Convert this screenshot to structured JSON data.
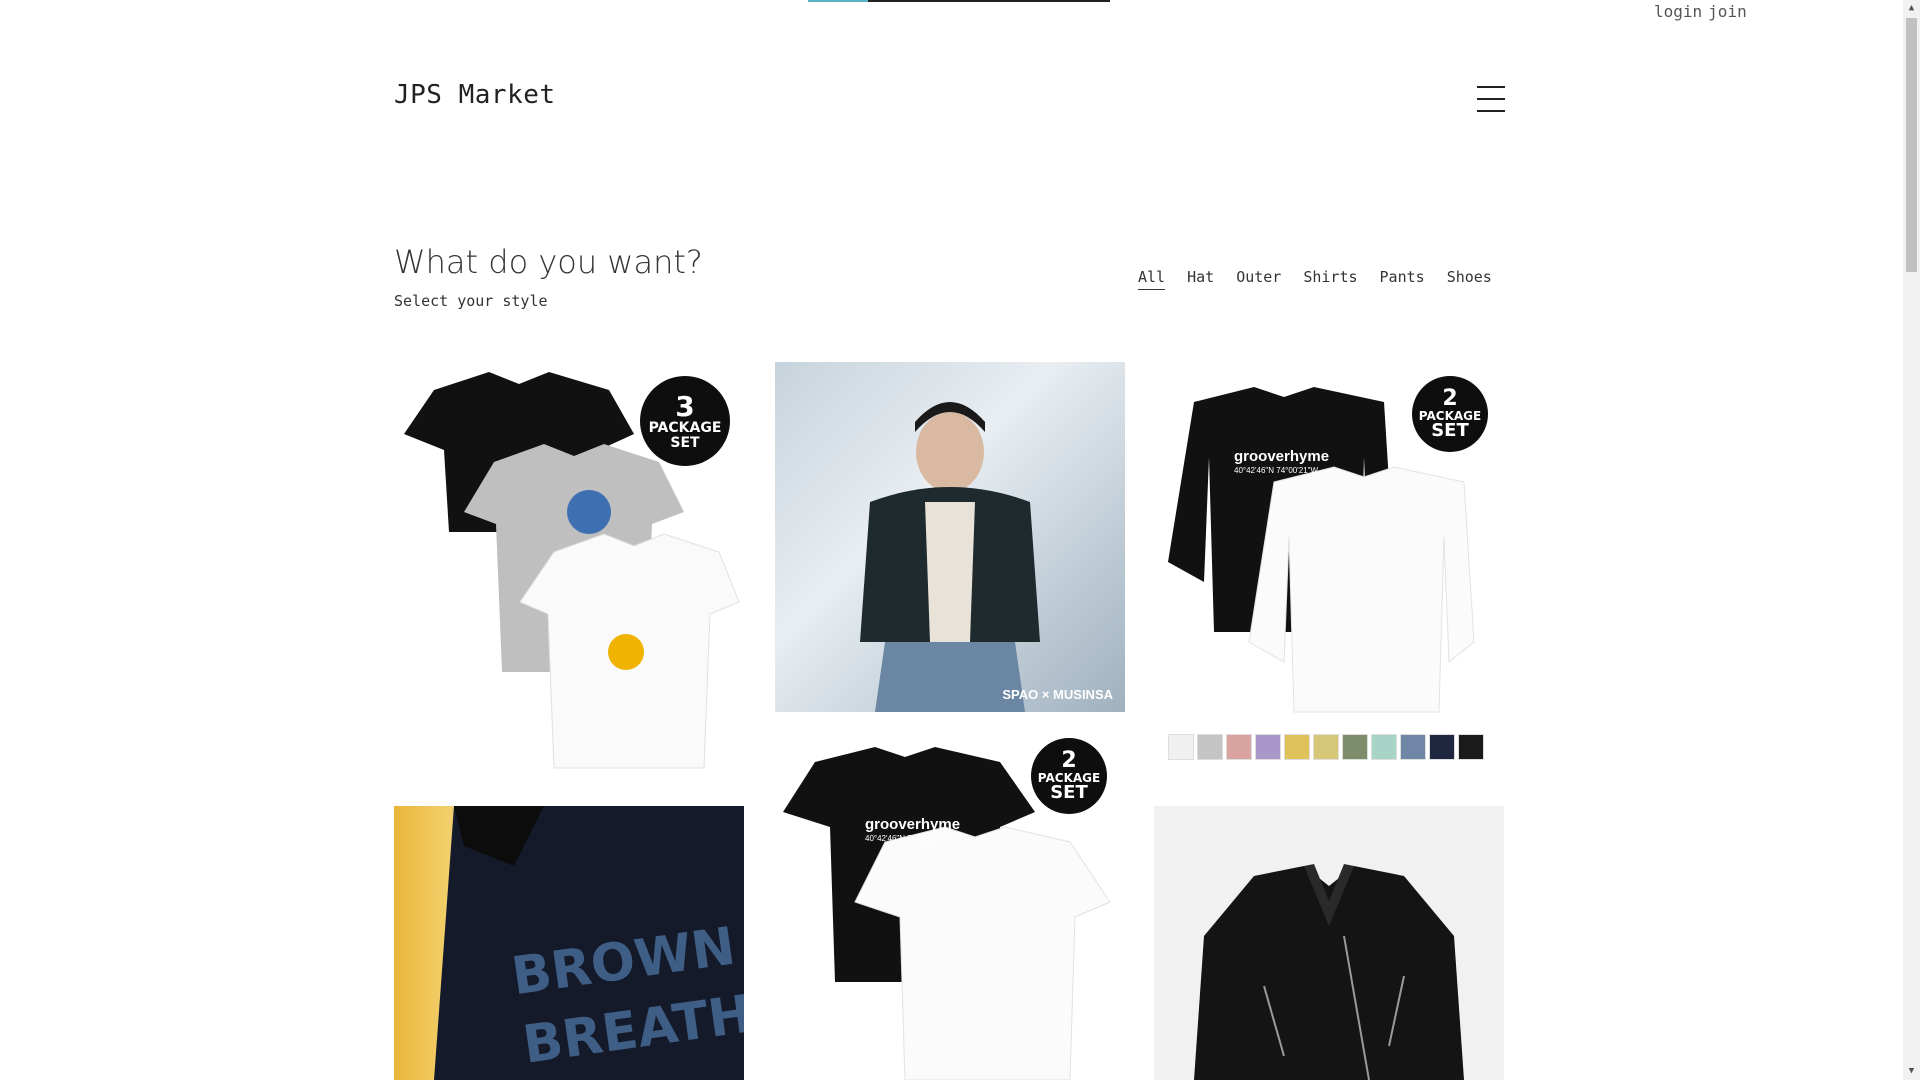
{
  "header": {
    "logo": "JPS Market",
    "login_label": "login",
    "join_label": "join",
    "progress": 0.2
  },
  "hero": {
    "title": "What do you want?",
    "subtitle": "Select your style"
  },
  "filters": [
    "All",
    "Hat",
    "Outer",
    "Shirts",
    "Pants",
    "Shoes"
  ],
  "active_filter": "All",
  "products": [
    {
      "badge_num": "3",
      "badge_word": "PACKAGE",
      "badge_set": "SET",
      "image": "three-tshirt-package"
    },
    {
      "caption": "SPAO × MUSINSA",
      "image": "padded-jacket-model"
    },
    {
      "badge_num": "2",
      "badge_word": "PACKAGE",
      "badge_set": "SET",
      "brand_text": "grooverhyme",
      "coords_text": "40°42'46\"N  74°00'21\"W",
      "image": "longsleeve-package"
    },
    {
      "image": "black-tshirt-model"
    },
    {
      "badge_num": "2",
      "badge_word": "PACKAGE",
      "badge_set": "SET",
      "brand_text": "grooverhyme",
      "coords_text": "40°42'46\"N  74°00'21\"W",
      "image": "tshirt-package"
    },
    {
      "image": "leather-rider-jacket"
    }
  ],
  "swatch_colors": [
    "#f0f0f0",
    "#c4c4c4",
    "#d9a4a0",
    "#a897c8",
    "#e0c25a",
    "#d6c878",
    "#7d8c6a",
    "#a8d4c8",
    "#6f86a6",
    "#1f2640",
    "#1a1a1a"
  ],
  "colors": {
    "accent": "#5ab4c8",
    "text": "#222222"
  }
}
